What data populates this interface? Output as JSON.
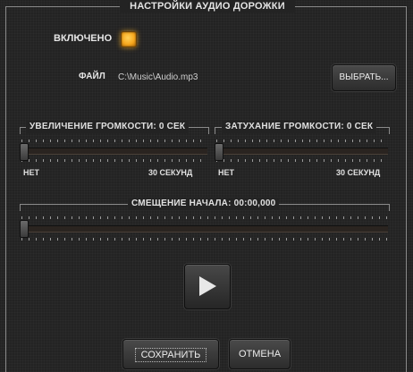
{
  "panel": {
    "title": "НАСТРОЙКИ АУДИО ДОРОЖКИ"
  },
  "enabled": {
    "label": "ВКЛЮЧЕНО",
    "checked": true,
    "color": "#f7a81e"
  },
  "file": {
    "label": "ФАЙЛ",
    "path": "C:\\Music\\Audio.mp3",
    "browse_label": "ВЫБРАТЬ..."
  },
  "fade_in": {
    "title": "УВЕЛИЧЕНИЕ ГРОМКОСТИ: 0 СЕК",
    "min_label": "НЕТ",
    "max_label": "30 СЕКУНД",
    "value": 0
  },
  "fade_out": {
    "title": "ЗАТУХАНИЕ ГРОМКОСТИ: 0 СЕК",
    "min_label": "НЕТ",
    "max_label": "30 СЕКУНД",
    "value": 0
  },
  "start_offset": {
    "title": "СМЕЩЕНИЕ НАЧАЛА: 00:00,000",
    "value": 0
  },
  "play": {
    "icon": "play-icon"
  },
  "footer": {
    "save_label": "СОХРАНИТЬ",
    "cancel_label": "ОТМЕНА"
  }
}
